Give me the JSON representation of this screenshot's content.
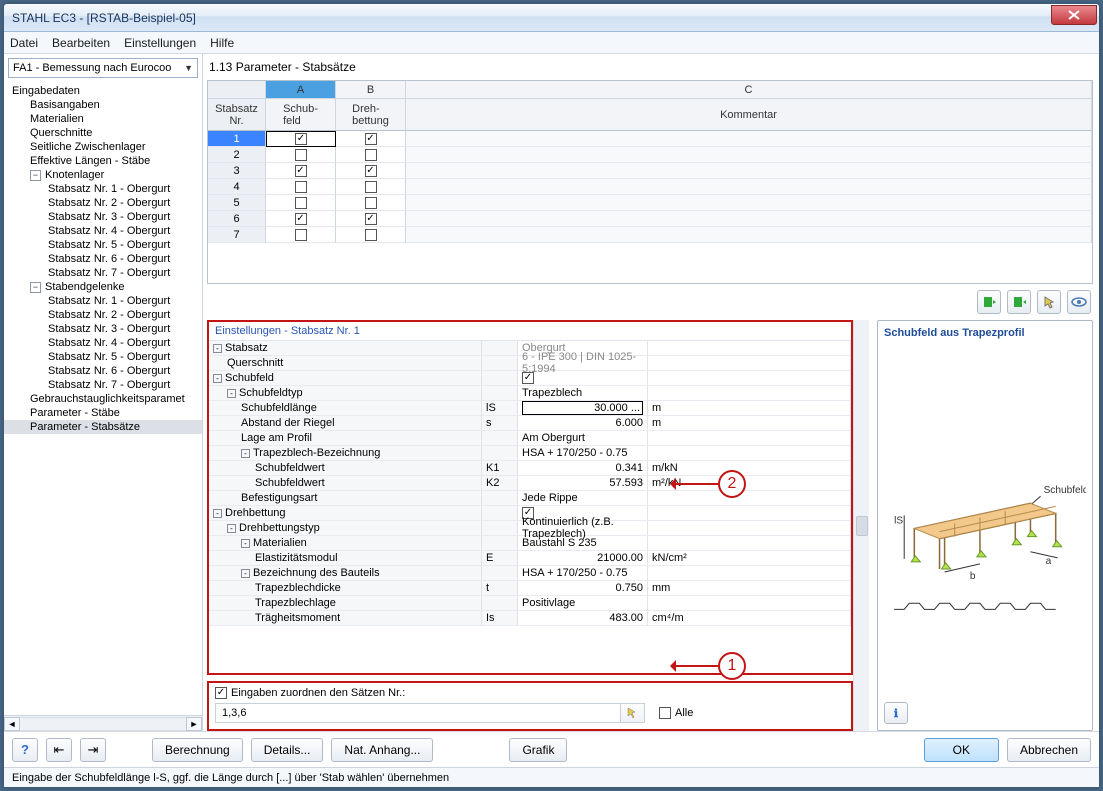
{
  "title": "STAHL EC3 - [RSTAB-Beispiel-05]",
  "menu": [
    "Datei",
    "Bearbeiten",
    "Einstellungen",
    "Hilfe"
  ],
  "dropdown": "FA1 - Bemessung nach Eurocoo",
  "tree": {
    "root": "Eingabedaten",
    "basis": "Basisangaben",
    "materialien": "Materialien",
    "querschnitte": "Querschnitte",
    "seitliche": "Seitliche Zwischenlager",
    "effektive": "Effektive Längen - Stäbe",
    "knotenlager": "Knotenlager",
    "kn1": "Stabsatz Nr. 1 - Obergurt",
    "kn2": "Stabsatz Nr. 2 - Obergurt",
    "kn3": "Stabsatz Nr. 3 - Obergurt",
    "kn4": "Stabsatz Nr. 4 - Obergurt",
    "kn5": "Stabsatz Nr. 5 - Obergurt",
    "kn6": "Stabsatz Nr. 6 - Obergurt",
    "kn7": "Stabsatz Nr. 7 - Obergurt",
    "stabend": "Stabendgelenke",
    "se1": "Stabsatz Nr. 1 - Obergurt",
    "se2": "Stabsatz Nr. 2 - Obergurt",
    "se3": "Stabsatz Nr. 3 - Obergurt",
    "se4": "Stabsatz Nr. 4 - Obergurt",
    "se5": "Stabsatz Nr. 5 - Obergurt",
    "se6": "Stabsatz Nr. 6 - Obergurt",
    "se7": "Stabsatz Nr. 7 - Obergurt",
    "gebrauch": "Gebrauchstauglichkeitsparamet",
    "paramStaebe": "Parameter - Stäbe",
    "paramSaetze": "Parameter - Stabsätze"
  },
  "pageTitle": "1.13 Parameter - Stabsätze",
  "grid": {
    "head1": {
      "nr": "Stabsatz",
      "A": "A",
      "B": "B",
      "C": "C"
    },
    "head2": {
      "nr": "Nr.",
      "A": "Schub-\nfeld",
      "B": "Dreh-\nbettung",
      "C": "Kommentar"
    },
    "rows": [
      {
        "nr": "1",
        "A": true,
        "B": true,
        "sel": true
      },
      {
        "nr": "2",
        "A": false,
        "B": false
      },
      {
        "nr": "3",
        "A": true,
        "B": true
      },
      {
        "nr": "4",
        "A": false,
        "B": false
      },
      {
        "nr": "5",
        "A": false,
        "B": false
      },
      {
        "nr": "6",
        "A": true,
        "B": true
      },
      {
        "nr": "7",
        "A": false,
        "B": false
      }
    ]
  },
  "settingsTitle": "Einstellungen - Stabsatz Nr. 1",
  "props": [
    {
      "c1": "Stabsatz",
      "pm": "-",
      "ind": 0,
      "c3": "Obergurt",
      "gray": true
    },
    {
      "c1": "Querschnitt",
      "ind": 1,
      "c3": "6 - IPE 300 | DIN 1025-5:1994",
      "gray": true
    },
    {
      "c1": "Schubfeld",
      "pm": "-",
      "ind": 0,
      "chk": true
    },
    {
      "c1": "Schubfeldtyp",
      "pm": "-",
      "ind": 1,
      "c3": "Trapezblech"
    },
    {
      "c1": "Schubfeldlänge",
      "ind": 2,
      "c2": "lS",
      "c3": "30.000 ...",
      "unit": "m",
      "boxed": true
    },
    {
      "c1": "Abstand der Riegel",
      "ind": 2,
      "c2": "s",
      "c3": "6.000",
      "unit": "m",
      "num": true
    },
    {
      "c1": "Lage am Profil",
      "ind": 2,
      "c3": "Am Obergurt"
    },
    {
      "c1": "Trapezblech-Bezeichnung",
      "pm": "-",
      "ind": 2,
      "c3": "HSA + 170/250 - 0.75"
    },
    {
      "c1": "Schubfeldwert",
      "ind": 3,
      "c2": "K1",
      "c3": "0.341",
      "unit": "m/kN",
      "num": true
    },
    {
      "c1": "Schubfeldwert",
      "ind": 3,
      "c2": "K2",
      "c3": "57.593",
      "unit": "m²/kN",
      "num": true
    },
    {
      "c1": "Befestigungsart",
      "ind": 2,
      "c3": "Jede Rippe"
    },
    {
      "c1": "Drehbettung",
      "pm": "-",
      "ind": 0,
      "chk": true
    },
    {
      "c1": "Drehbettungstyp",
      "pm": "-",
      "ind": 1,
      "c3": "Kontinuierlich (z.B. Trapezblech)"
    },
    {
      "c1": "Materialien",
      "pm": "-",
      "ind": 2,
      "c3": "Baustahl S 235"
    },
    {
      "c1": "Elastizitätsmodul",
      "ind": 3,
      "c2": "E",
      "c3": "21000.00",
      "unit": "kN/cm²",
      "num": true
    },
    {
      "c1": "Bezeichnung des Bauteils",
      "pm": "-",
      "ind": 2,
      "c3": "HSA + 170/250 - 0.75"
    },
    {
      "c1": "Trapezblechdicke",
      "ind": 3,
      "c2": "t",
      "c3": "0.750",
      "unit": "mm",
      "num": true
    },
    {
      "c1": "Trapezblechlage",
      "ind": 3,
      "c3": "Positivlage"
    },
    {
      "c1": "Trägheitsmoment",
      "ind": 3,
      "c2": "Is",
      "c3": "483.00",
      "unit": "cm⁴/m",
      "num": true
    }
  ],
  "illustTitle": "Schubfeld aus Trapezprofil",
  "illustLabel": {
    "ls": "lS",
    "b": "b",
    "a": "a",
    "schubfeld": "Schubfeld"
  },
  "assign": {
    "label": "Eingaben zuordnen den Sätzen Nr.:",
    "value": "1,3,6",
    "alle": "Alle"
  },
  "buttons": {
    "help": "?",
    "berechnung": "Berechnung",
    "details": "Details...",
    "natAnhang": "Nat. Anhang...",
    "grafik": "Grafik",
    "ok": "OK",
    "abbrechen": "Abbrechen"
  },
  "status": "Eingabe der Schubfeldlänge l-S, ggf. die Länge durch [...] über 'Stab wählen' übernehmen",
  "callouts": {
    "one": "1",
    "two": "2"
  }
}
